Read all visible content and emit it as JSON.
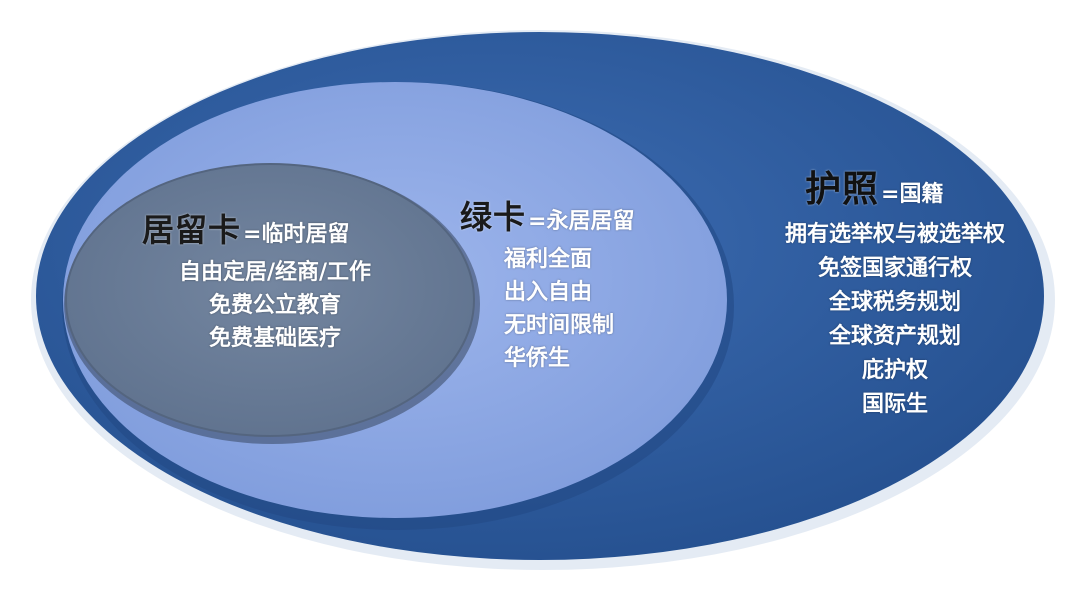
{
  "colors": {
    "outer_ellipse": "#2f5c9e",
    "middle_ellipse": "#8aa6e2",
    "inner_ellipse": "#6b7f9a",
    "text_dark": "#1a1a1a",
    "text_light": "#ffffff"
  },
  "residence_card": {
    "title": "居留卡",
    "equals": "=临时居留",
    "items": [
      "自由定居/经商/工作",
      "免费公立教育",
      "免费基础医疗"
    ]
  },
  "green_card": {
    "title": "绿卡",
    "equals": "=永居居留",
    "items": [
      "福利全面",
      "出入自由",
      "无时间限制",
      "华侨生"
    ]
  },
  "passport": {
    "title": "护照",
    "equals": "=国籍",
    "items": [
      "拥有选举权与被选举权",
      "免签国家通行权",
      "全球税务规划",
      "全球资产规划",
      "庇护权",
      "国际生"
    ]
  }
}
